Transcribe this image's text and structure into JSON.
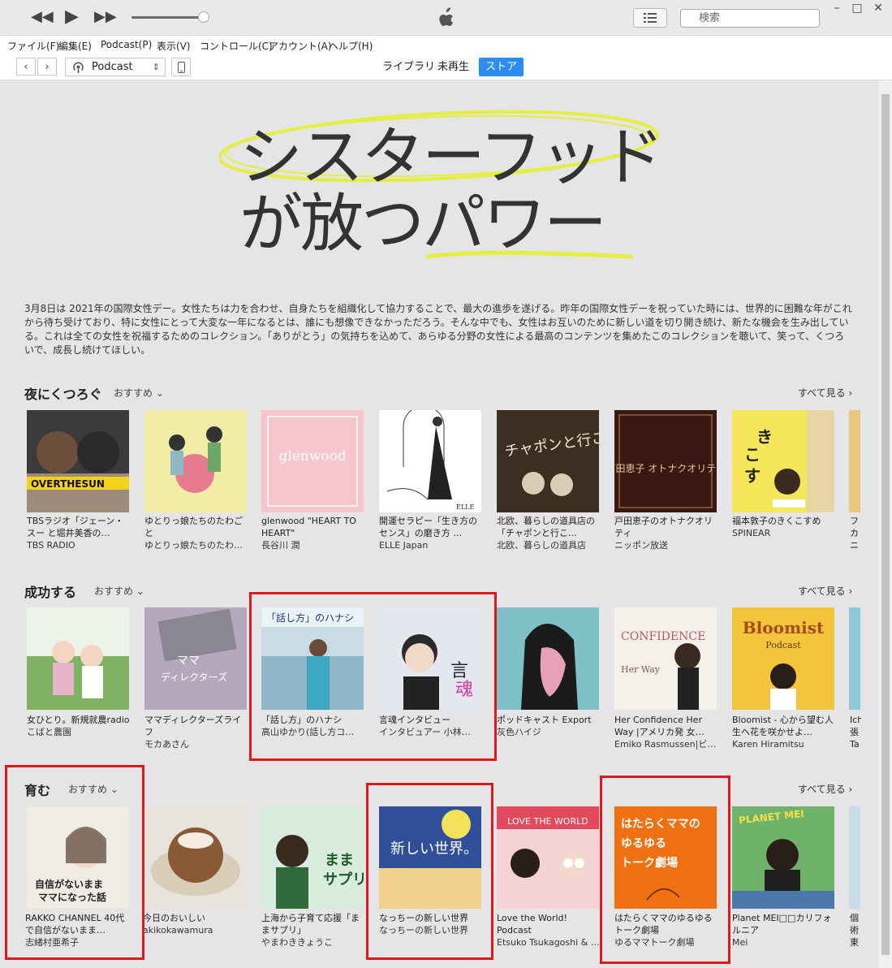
{
  "window": {
    "search_placeholder": "検索",
    "controls": [
      "–",
      "□",
      "✕"
    ]
  },
  "menu": [
    "ファイル(F)",
    "編集(E)",
    "Podcast(P)",
    "表示(V)",
    "コントロール(C)",
    "アカウント(A)",
    "ヘルプ(H)"
  ],
  "nav": {
    "media": "Podcast",
    "tabs": [
      "ライブラリ",
      "未再生",
      "ストア"
    ],
    "active_tab": "ストア"
  },
  "hero": {
    "line1": "シスターフッド",
    "line2": "が放つパワー",
    "accent_color": "#e4ee3c"
  },
  "description": "3月8日は 2021年の国際女性デー。女性たちは力を合わせ、自身たちを組織化して協力することで、最大の進歩を遂げる。昨年の国際女性デーを祝っていた時には、世界的に困難な年がこれから待ち受けており、特に女性にとって大変な一年になるとは、誰にも想像できなかっただろう。そんな中でも、女性はお互いのために新しい道を切り開き続け、新たな機会を生み出している。これは全ての女性を祝福するためのコレクション。「ありがとう」の気持ちを込めて、あらゆる分野の女性による最高のコンテンツを集めたこのコレクションを聴いて、笑って、くつろいで、成長し続けてほしい。",
  "sections": [
    {
      "title": "夜にくつろぐ",
      "recommend": "おすすめ",
      "see_all": "すべて見る",
      "items": [
        {
          "title": "TBSラジオ「ジェーン・スー と堀井美香の…",
          "author": "TBS RADIO",
          "art_text": "OVERTHESUN"
        },
        {
          "title": "ゆとりっ娘たちのたわごと",
          "author": "ゆとりっ娘たちのたわ…",
          "art_text": ""
        },
        {
          "title": "glenwood \"HEART TO HEART\"",
          "author": "長谷川 潤",
          "art_text": "glenwood"
        },
        {
          "title": "開運セラピー「生き方のセンス」の磨き方 …",
          "author": "ELLE Japan",
          "art_text": "ELLE"
        },
        {
          "title": "北欧、暮らしの道具店の「チャポンと行こ…",
          "author": "北欧、暮らしの道具店",
          "art_text": "チャポンと行こう!"
        },
        {
          "title": "戸田恵子のオトナクオリティ",
          "author": "ニッポン放送",
          "art_text": "戸田恵子 オトナクオリティ"
        },
        {
          "title": "福本敦子のきくこすめ",
          "author": "SPINEAR",
          "art_text": "きくこすめ"
        },
        {
          "title": "フ カ ニ",
          "author": "",
          "art_text": ""
        }
      ]
    },
    {
      "title": "成功する",
      "recommend": "おすすめ",
      "see_all": "すべて見る",
      "items": [
        {
          "title": "女ひとり。新規就農radio",
          "author": "こばと農園",
          "art_text": "女ひとり。新規就農radio"
        },
        {
          "title": "ママディレクターズライフ",
          "author": "モカあさん",
          "art_text": "ママディレクターズライフ"
        },
        {
          "title": "「話し方」のハナシ",
          "author": "高山ゆかり(話し方コ…",
          "art_text": "「話し方」のハナシ"
        },
        {
          "title": "言魂インタビュー",
          "author": "インタビュアー 小林…",
          "art_text": "言魂"
        },
        {
          "title": "ポッドキャスト Export",
          "author": "灰色ハイジ",
          "art_text": ""
        },
        {
          "title": "Her Confidence Her Way |アメリカ発 女…",
          "author": "Emiko Rasmussen|ビ…",
          "art_text": "Her CONFIDENCE Her Way"
        },
        {
          "title": "Bloomist - 心から望む人生へ花を咲かせよ…",
          "author": "Karen Hiramitsu",
          "art_text": "Bloomist"
        },
        {
          "title": "Ich 張 Ta",
          "author": "",
          "art_text": ""
        }
      ]
    },
    {
      "title": "育む",
      "recommend": "おすすめ",
      "see_all": "すべて見る",
      "items": [
        {
          "title": "RAKKO CHANNEL 40代で自信がないまま…",
          "author": "志緒村亜希子",
          "art_text": "自信がないまま ママになった話"
        },
        {
          "title": "今日のおいしい",
          "author": "akikokawamura",
          "art_text": ""
        },
        {
          "title": "上海から子育て応援「ままサプリ」",
          "author": "やまわききょうこ",
          "art_text": "ままサプリ"
        },
        {
          "title": "なっちーの新しい世界",
          "author": "なっちーの新しい世界",
          "art_text": "新しい世界。"
        },
        {
          "title": "Love the World! Podcast",
          "author": "Etsuko Tsukagoshi & …",
          "art_text": "LOVE THE WORLD"
        },
        {
          "title": "はたらくママのゆるゆるトーク劇場",
          "author": "ゆるママトーク劇場",
          "art_text": "はたらくママの ゆるゆる トーク劇場"
        },
        {
          "title": "Planet MEI□□カリフォルニア",
          "author": "Mei",
          "art_text": "PLANET MEI"
        },
        {
          "title": "個 術 東",
          "author": "",
          "art_text": ""
        }
      ]
    }
  ]
}
